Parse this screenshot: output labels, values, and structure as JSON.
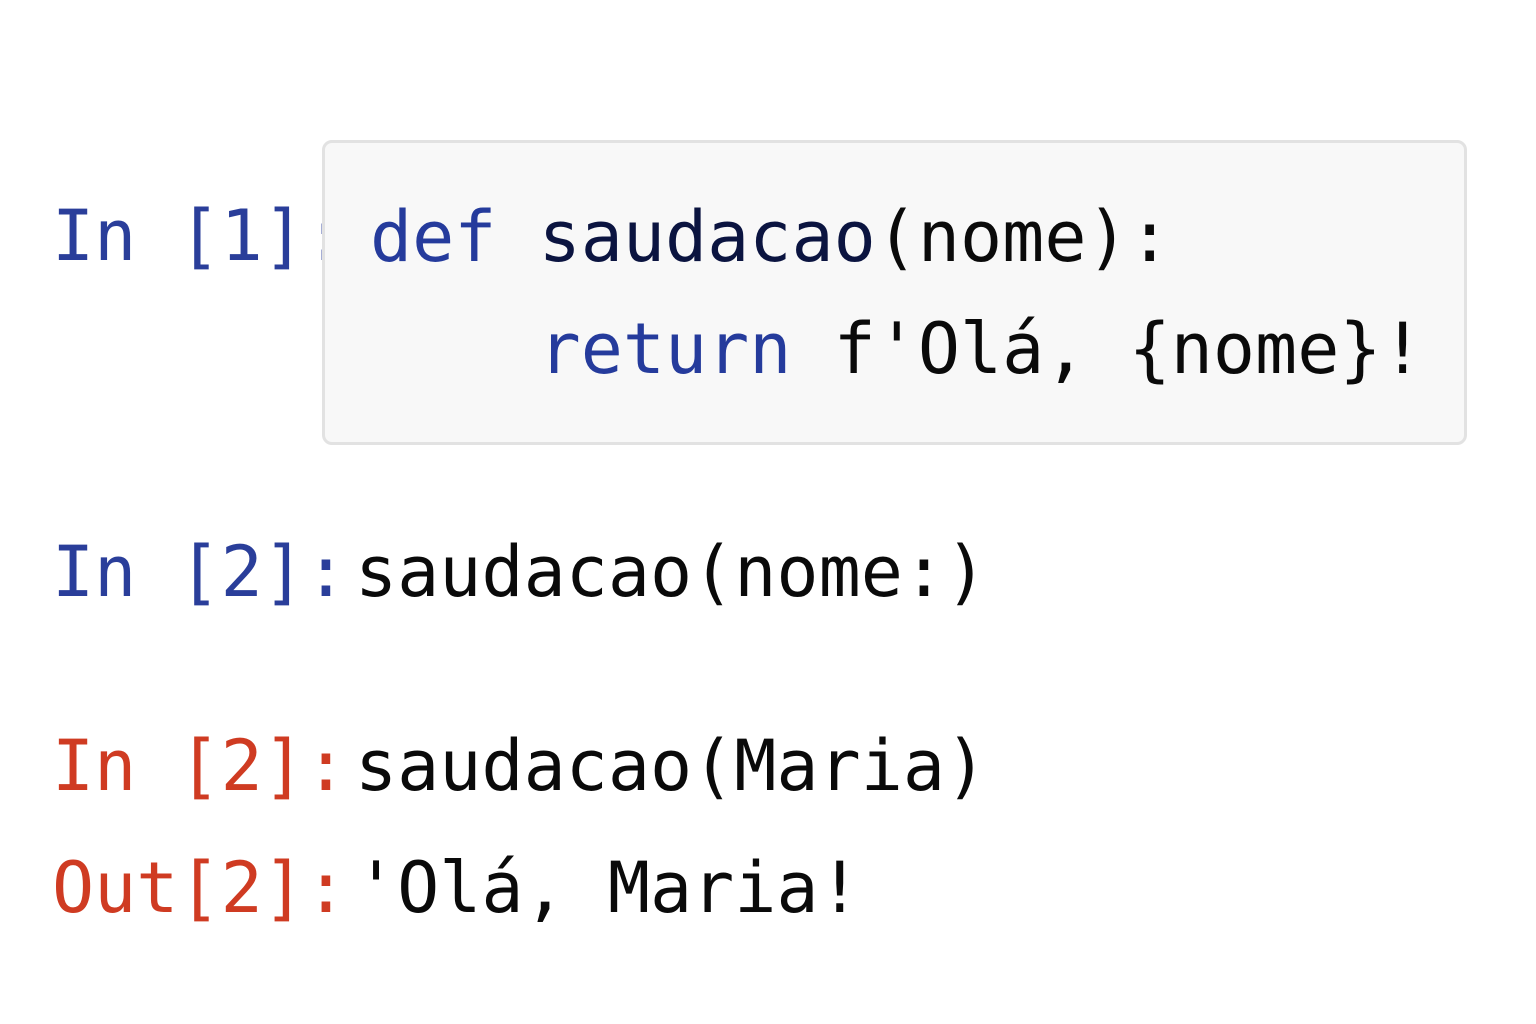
{
  "cells": [
    {
      "prompt": "In [1]:",
      "code": {
        "line1": {
          "keyword": "def",
          "function_name": "saudacao",
          "rest": "(nome):"
        },
        "line2": {
          "indent": "    ",
          "keyword": "return",
          "rest": "f'Olá, {nome}!"
        }
      }
    },
    {
      "prompt": "In [2]:",
      "input": "saudacao(nome:)"
    },
    {
      "prompt": "In [2]:",
      "input": "saudacao(Maria)"
    },
    {
      "prompt": "Out[2]:",
      "output": "'Olá, Maria!"
    }
  ],
  "colors": {
    "prompt_in": "#2a3e9a",
    "prompt_error": "#cf3b22",
    "keyword": "#253b9c",
    "code_background": "#f8f8f8"
  }
}
